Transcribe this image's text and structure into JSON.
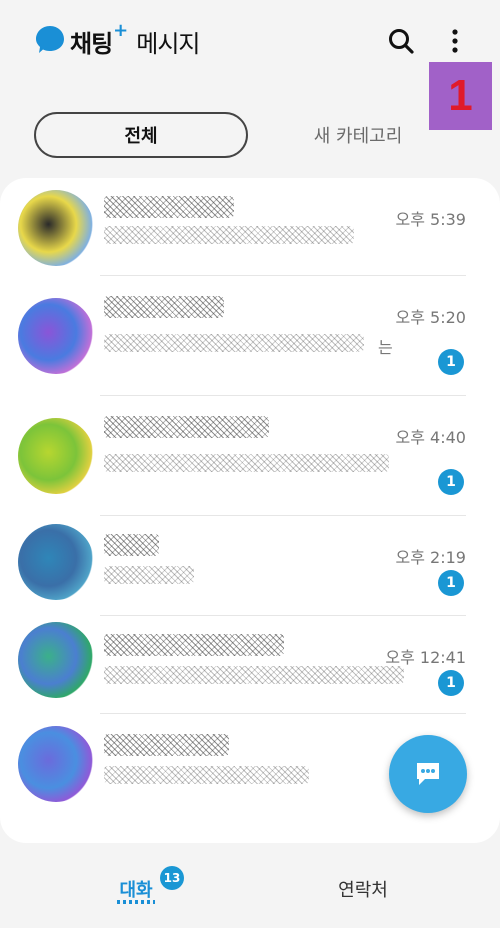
{
  "header": {
    "brand": "채팅",
    "brand_plus": "+",
    "title": "메시지",
    "annotation_number": "1",
    "icons": {
      "logo": "chat-bubble-icon",
      "search": "search-icon",
      "more": "more-vertical-icon"
    }
  },
  "tabs": [
    {
      "label": "전체",
      "selected": true
    },
    {
      "label": "새 카테고리",
      "selected": false
    }
  ],
  "conversations": [
    {
      "time": "오후 5:39",
      "unread": "",
      "preview_suffix": "",
      "avatar_colors": [
        "#2a2a2a",
        "#e8d84a",
        "#7fb0e0"
      ]
    },
    {
      "time": "오후 5:20",
      "unread": "1",
      "preview_suffix": "는",
      "avatar_colors": [
        "#8a55d8",
        "#4a7be0",
        "#c070d8"
      ]
    },
    {
      "time": "오후 4:40",
      "unread": "1",
      "preview_suffix": "",
      "avatar_colors": [
        "#b7d630",
        "#7cc43a",
        "#e0d040"
      ]
    },
    {
      "time": "오후 2:19",
      "unread": "1",
      "preview_suffix": "",
      "avatar_colors": [
        "#2f86b8",
        "#3a6fa8",
        "#4fa3c8"
      ]
    },
    {
      "time": "오후 12:41",
      "unread": "1",
      "preview_suffix": "",
      "avatar_colors": [
        "#3bb08a",
        "#4b7fd0",
        "#2fa868"
      ]
    },
    {
      "time": "",
      "unread": "",
      "preview_suffix": "",
      "avatar_colors": [
        "#6b6bdc",
        "#4a8fe0",
        "#8f5ad8"
      ]
    }
  ],
  "fab": {
    "icon": "new-chat-icon"
  },
  "bottom_nav": {
    "chats_label": "대화",
    "chats_badge": "13",
    "contacts_label": "연락처"
  }
}
